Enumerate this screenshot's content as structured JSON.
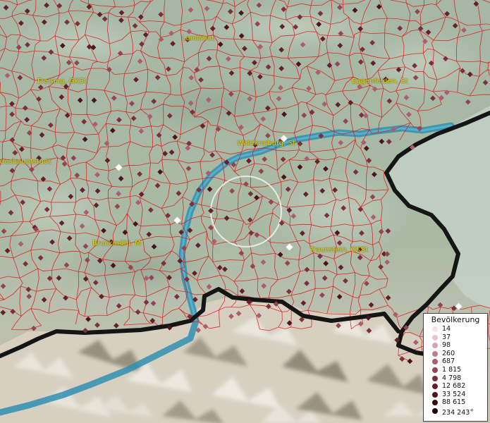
{
  "map": {
    "cities": [
      {
        "id": "landshut",
        "label": "Landshut"
      },
      {
        "id": "freising",
        "label": "Freising, GKSt"
      },
      {
        "id": "eggenfelden",
        "label": "Eggenfelden, St"
      },
      {
        "id": "waldkraiburg",
        "label": "Waldkraiburg, St"
      },
      {
        "id": "landeshauptstadt",
        "label": "deshauptstadt"
      },
      {
        "id": "bruckmuehl",
        "label": "Bruckmühl, M"
      },
      {
        "id": "traunstein",
        "label": "Traunstein, GKSt"
      }
    ]
  },
  "legend": {
    "title": "Bevölkerung",
    "items": [
      {
        "label": "14",
        "color": "#f6e3ea"
      },
      {
        "label": "37",
        "color": "#e9c3cf"
      },
      {
        "label": "98",
        "color": "#d7a2b1"
      },
      {
        "label": "260",
        "color": "#c17d8e"
      },
      {
        "label": "687",
        "color": "#aa5e6e"
      },
      {
        "label": "1 815",
        "color": "#944552"
      },
      {
        "label": "4 798",
        "color": "#7c2f3c"
      },
      {
        "label": "12 682",
        "color": "#64202b"
      },
      {
        "label": "33 524",
        "color": "#4b141c"
      },
      {
        "label": "88 615",
        "color": "#330a10"
      },
      {
        "label": "234 243",
        "color": "#1b0306",
        "plus": "+"
      }
    ]
  },
  "colors": {
    "boundary": "#e0191b",
    "border": "#151515",
    "river": "#2f8fb0"
  }
}
